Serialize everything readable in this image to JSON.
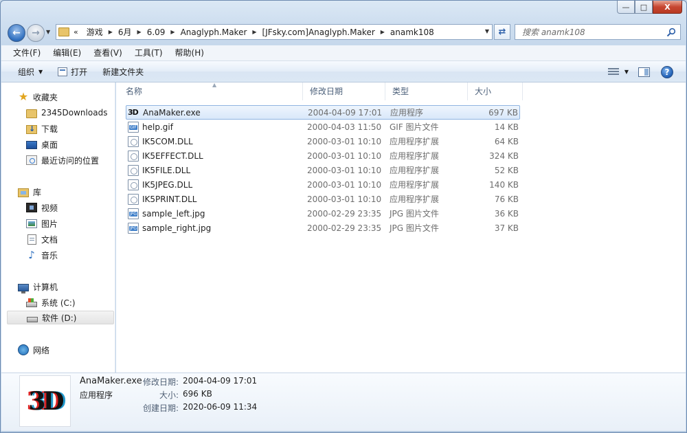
{
  "caption": {
    "minimize": "—",
    "maximize": "□",
    "close": "X"
  },
  "address": {
    "overflow": "«",
    "crumbs": [
      "游戏",
      "6月",
      "6.09",
      "Anaglyph.Maker",
      "[JFsky.com]Anaglyph.Maker",
      "anamk108"
    ]
  },
  "search": {
    "placeholder": "搜索 anamk108"
  },
  "menu": {
    "file": "文件(F)",
    "edit": "编辑(E)",
    "view": "查看(V)",
    "tools": "工具(T)",
    "help": "帮助(H)"
  },
  "toolbar": {
    "organize": "组织",
    "open": "打开",
    "new_folder": "新建文件夹",
    "help_glyph": "?"
  },
  "nav": {
    "favorites": "收藏夹",
    "fav_items": [
      "2345Downloads",
      "下载",
      "桌面",
      "最近访问的位置"
    ],
    "libraries": "库",
    "lib_items": [
      "视频",
      "图片",
      "文档",
      "音乐"
    ],
    "computer": "计算机",
    "drives": [
      "系统 (C:)",
      "软件 (D:)"
    ],
    "network": "网络"
  },
  "columns": {
    "name": "名称",
    "date": "修改日期",
    "type": "类型",
    "size": "大小"
  },
  "files": [
    {
      "name": "AnaMaker.exe",
      "date": "2004-04-09 17:01",
      "type": "应用程序",
      "size": "697 KB",
      "icon": "3D"
    },
    {
      "name": "help.gif",
      "date": "2000-04-03 11:50",
      "type": "GIF 图片文件",
      "size": "14 KB",
      "icon": "GIF"
    },
    {
      "name": "IK5COM.DLL",
      "date": "2000-03-01 10:10",
      "type": "应用程序扩展",
      "size": "64 KB",
      "icon": "dll"
    },
    {
      "name": "IK5EFFECT.DLL",
      "date": "2000-03-01 10:10",
      "type": "应用程序扩展",
      "size": "324 KB",
      "icon": "dll"
    },
    {
      "name": "IK5FILE.DLL",
      "date": "2000-03-01 10:10",
      "type": "应用程序扩展",
      "size": "52 KB",
      "icon": "dll"
    },
    {
      "name": "IK5JPEG.DLL",
      "date": "2000-03-01 10:10",
      "type": "应用程序扩展",
      "size": "140 KB",
      "icon": "dll"
    },
    {
      "name": "IK5PRINT.DLL",
      "date": "2000-03-01 10:10",
      "type": "应用程序扩展",
      "size": "76 KB",
      "icon": "dll"
    },
    {
      "name": "sample_left.jpg",
      "date": "2000-02-29 23:35",
      "type": "JPG 图片文件",
      "size": "36 KB",
      "icon": "JPG"
    },
    {
      "name": "sample_right.jpg",
      "date": "2000-02-29 23:35",
      "type": "JPG 图片文件",
      "size": "37 KB",
      "icon": "JPG"
    }
  ],
  "details": {
    "thumb": "3D",
    "name": "AnaMaker.exe",
    "type": "应用程序",
    "modified_label": "修改日期:",
    "modified": "2004-04-09 17:01",
    "size_label": "大小:",
    "size": "696 KB",
    "created_label": "创建日期:",
    "created": "2020-06-09 11:34"
  }
}
